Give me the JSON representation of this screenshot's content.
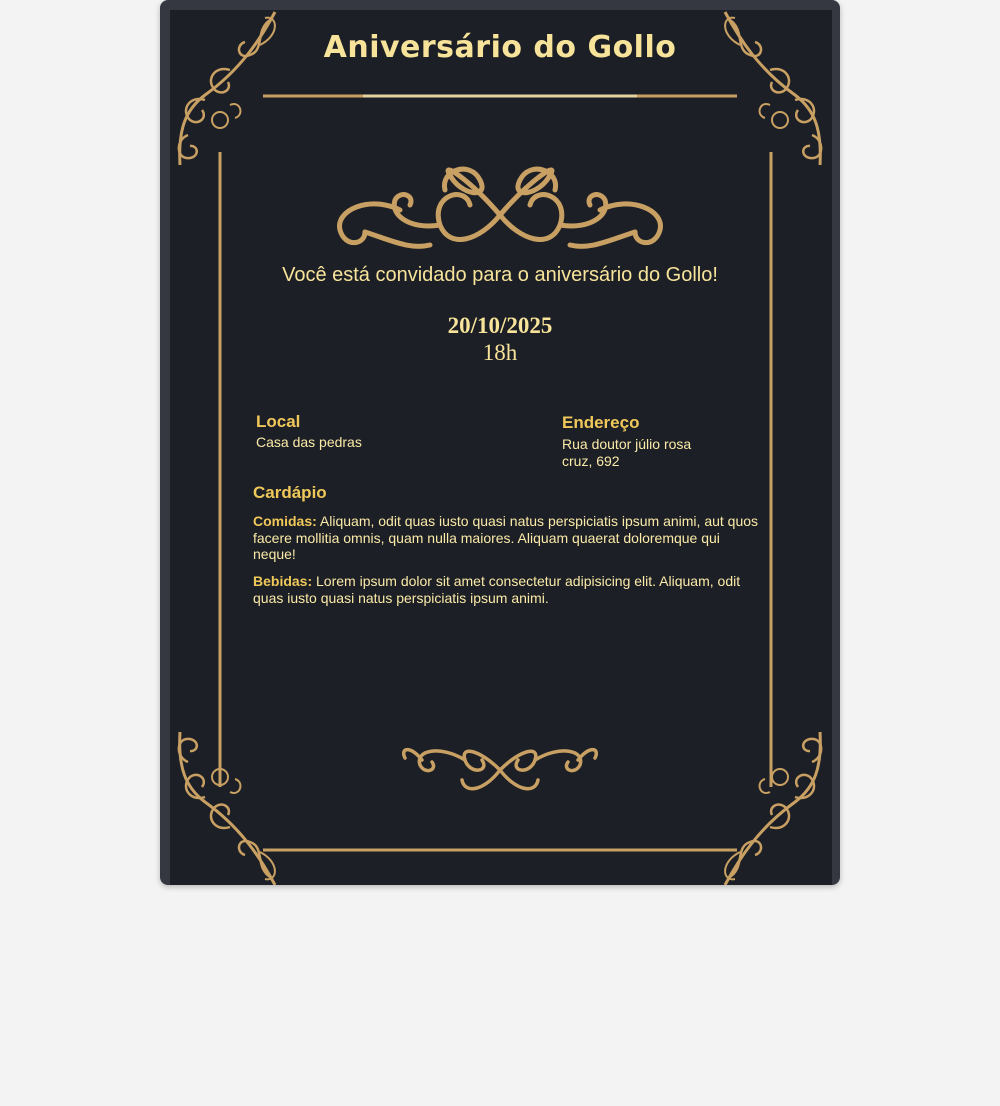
{
  "invite": {
    "title": "Aniversário do Gollo",
    "subtitle": "Você está convidado para o aniversário do Gollo!",
    "date": "20/10/2025",
    "time": "18h"
  },
  "location": {
    "heading": "Local",
    "value": "Casa das pedras"
  },
  "address": {
    "heading": "Endereço",
    "line1": "Rua doutor júlio rosa",
    "line2": "cruz, 692"
  },
  "menu": {
    "heading": "Cardápio",
    "food_label": "Comidas:",
    "food_text": " Aliquam, odit quas iusto quasi natus perspiciatis ipsum animi, aut quos facere mollitia omnis, quam nulla maiores. Aliquam quaerat doloremque qui neque!",
    "drinks_label": "Bebidas:",
    "drinks_text": " Lorem ipsum dolor sit amet consectetur adipisicing elit. Aliquam, odit quas iusto quasi natus perspiciatis ipsum animi."
  },
  "colors": {
    "page_background": "#f3f3f3",
    "card_background": "#1c1f25",
    "gold_ornament": "#c9a063",
    "title_text": "#f7e39a",
    "heading_text": "#f0c85a"
  },
  "ornaments": {
    "corner_icon": "corner-flourish-icon",
    "top_icon": "scroll-flourish-icon",
    "bottom_icon": "small-scroll-flourish-icon"
  }
}
